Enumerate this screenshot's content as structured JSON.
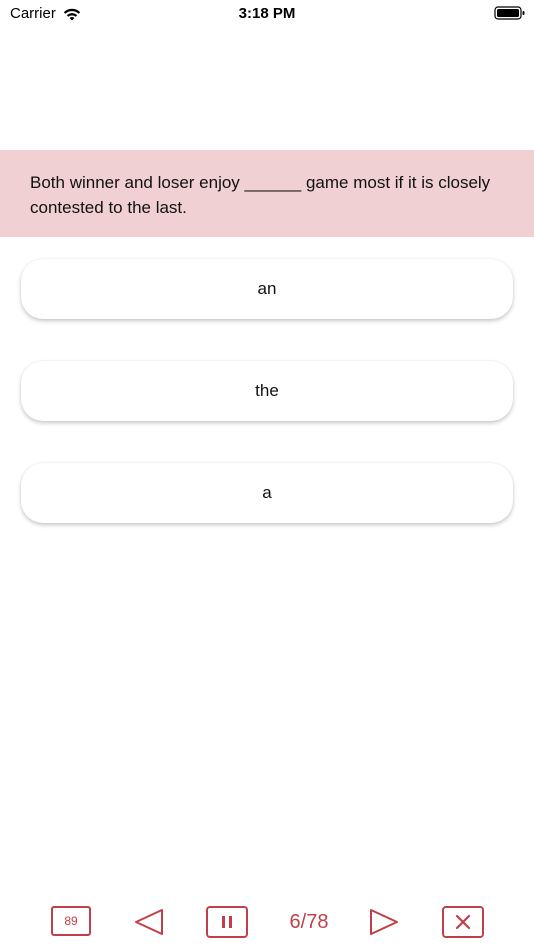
{
  "status_bar": {
    "carrier": "Carrier",
    "time": "3:18 PM"
  },
  "question": {
    "text": "Both winner and loser enjoy ______ game most if it is closely contested to the last."
  },
  "options": [
    {
      "label": "an"
    },
    {
      "label": "the"
    },
    {
      "label": "a"
    }
  ],
  "toolbar": {
    "badge_count": "89",
    "progress": "6/78"
  },
  "colors": {
    "accent": "#c0404a",
    "banner_bg": "#f0d0d3"
  },
  "icons": {
    "wifi": "wifi-icon",
    "battery": "battery-icon",
    "prev": "triangle-left-icon",
    "pause": "pause-icon",
    "next": "triangle-right-icon",
    "close": "close-icon"
  }
}
